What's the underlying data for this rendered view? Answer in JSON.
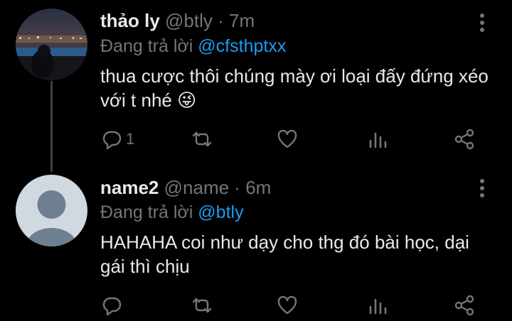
{
  "tweets": [
    {
      "display_name": "thảo ly",
      "handle": "@btly",
      "separator": "·",
      "time": "7m",
      "replying_label": "Đang trả lời",
      "replying_to": "@cfsthptxx",
      "text": "thua cược thôi chúng mày ơi loại đấy đứng xéo với t nhé",
      "emoji": "😜",
      "reply_count": "1"
    },
    {
      "display_name": "name2",
      "handle": "@name",
      "separator": "·",
      "time": "6m",
      "replying_label": "Đang trả lời",
      "replying_to": "@btly",
      "text": "HAHAHA coi như dạy cho thg đó bài học, dại gái thì chịu",
      "reply_count": ""
    }
  ],
  "icons": [
    "reply-icon",
    "retweet-icon",
    "like-icon",
    "analytics-icon",
    "share-icon",
    "more-icon"
  ],
  "colors": {
    "background": "#000000",
    "text": "#e7e9ea",
    "muted": "#71767b",
    "link": "#1d9bf0"
  }
}
